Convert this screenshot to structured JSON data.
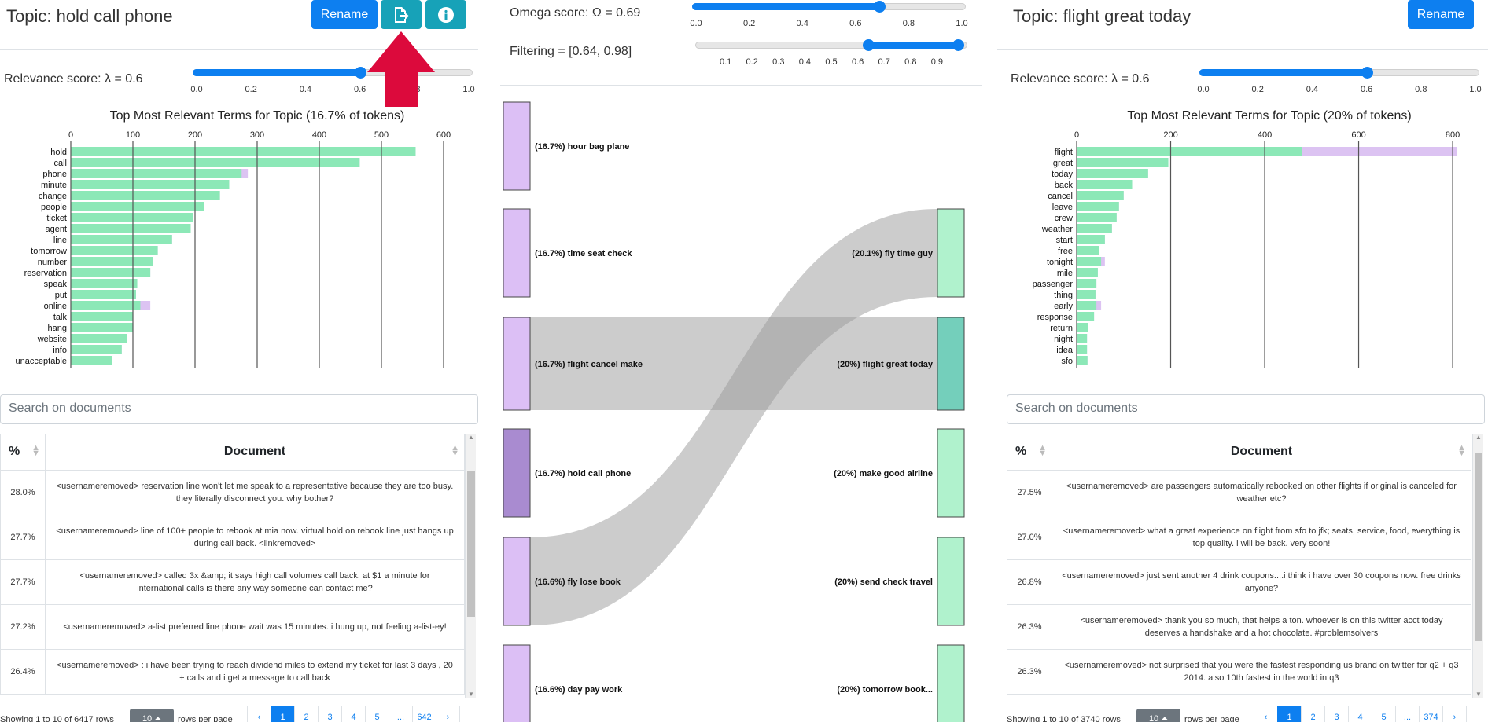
{
  "left": {
    "title": "Topic: hold call phone",
    "rename_label": "Rename",
    "relevance_label": "Relevance score: λ = 0.6",
    "lambda": 0.6,
    "lambda_ticks": [
      "0.0",
      "0.2",
      "0.4",
      "0.6",
      "0.8",
      "1.0"
    ],
    "search_placeholder": "Search on documents",
    "table": {
      "headers": [
        "%",
        "Document"
      ],
      "rows": [
        {
          "pct": "28.0%",
          "doc": "<usernameremoved> reservation line won't let me speak to a representative because they are too busy. they literally disconnect you. why bother?"
        },
        {
          "pct": "27.7%",
          "doc": "<usernameremoved> line of 100+ people to rebook at mia now. virtual hold on rebook line just hangs up during call back. <linkremoved>"
        },
        {
          "pct": "27.7%",
          "doc": "<usernameremoved> called 3x &amp; it says high call volumes call back. at $1 a minute for international calls is there any way someone can contact me?"
        },
        {
          "pct": "27.2%",
          "doc": "<usernameremoved> a-list preferred line phone wait was 15 minutes. i hung up, not feeling a-list-ey!"
        },
        {
          "pct": "26.4%",
          "doc": "<usernameremoved> : i have been trying to reach dividend miles to extend my ticket for last 3 days , 20 + calls and i get a message to call back"
        }
      ]
    },
    "pager": {
      "info": "Showing 1 to 10 of 6417 rows",
      "rows_per_page_value": "10",
      "rows_per_page_label": "rows per page",
      "pages": [
        "‹",
        "1",
        "2",
        "3",
        "4",
        "5",
        "...",
        "642",
        "›"
      ],
      "active_page": "1"
    }
  },
  "middle": {
    "omega_label": "Omega score: Ω = 0.69",
    "omega": 0.69,
    "omega_ticks": [
      "0.0",
      "0.2",
      "0.4",
      "0.6",
      "0.8",
      "1.0"
    ],
    "filter_label": "Filtering = [0.64, 0.98]",
    "filter_range": [
      0.64,
      0.98
    ],
    "filter_ticks": [
      "0.1",
      "0.2",
      "0.3",
      "0.4",
      "0.5",
      "0.6",
      "0.7",
      "0.8",
      "0.9"
    ],
    "left_nodes": [
      "(16.7%) hour bag plane",
      "(16.7%) time seat check",
      "(16.7%) flight cancel make",
      "(16.7%) hold call phone",
      "(16.6%) fly lose book",
      "(16.6%) day pay work"
    ],
    "right_nodes": [
      "(20.1%) fly time guy",
      "(20%) flight great today",
      "(20%) make good airline",
      "(20%) send check travel",
      "(20%) tomorrow book..."
    ],
    "links": [
      {
        "source": "(16.7%) flight cancel make",
        "target": "(20%) flight great today",
        "value": 0.98
      },
      {
        "source": "(16.6%) fly lose book",
        "target": "(20.1%) fly time guy",
        "value": 0.86
      }
    ],
    "colors": {
      "left_node": "#dcbff5",
      "selected_left": "#a98bd0",
      "right_node": "#b0f2cd",
      "selected_right": "#74cfbb",
      "link": "#9a9a9a"
    }
  },
  "right": {
    "title": "Topic: flight great today",
    "rename_label": "Rename",
    "relevance_label": "Relevance score: λ = 0.6",
    "lambda": 0.6,
    "lambda_ticks": [
      "0.0",
      "0.2",
      "0.4",
      "0.6",
      "0.8",
      "1.0"
    ],
    "search_placeholder": "Search on documents",
    "table": {
      "headers": [
        "%",
        "Document"
      ],
      "rows": [
        {
          "pct": "27.5%",
          "doc": "<usernameremoved> are passengers automatically rebooked on other flights if original is canceled for weather etc?"
        },
        {
          "pct": "27.0%",
          "doc": "<usernameremoved> what a great experience on flight from sfo to jfk; seats, service, food, everything is top quality. i will be back. very soon!"
        },
        {
          "pct": "26.8%",
          "doc": "<usernameremoved> just sent another 4 drink coupons....i think i have over 30 coupons now. free drinks anyone?"
        },
        {
          "pct": "26.3%",
          "doc": "<usernameremoved> thank you so much, that helps a ton. whoever is on this twitter acct today deserves a handshake and a hot chocolate. #problemsolvers"
        },
        {
          "pct": "26.3%",
          "doc": "<usernameremoved> not surprised that you were the fastest responding us brand on twitter for q2 + q3 2014. also 10th fastest in the world in q3"
        }
      ]
    },
    "pager": {
      "info": "Showing 1 to 10 of 3740 rows",
      "rows_per_page_value": "10",
      "rows_per_page_label": "rows per page",
      "pages": [
        "‹",
        "1",
        "2",
        "3",
        "4",
        "5",
        "...",
        "374",
        "›"
      ],
      "active_page": "1"
    }
  },
  "chart_data": [
    {
      "type": "bar",
      "orientation": "horizontal",
      "title": "Top Most Relevant Terms for Topic (16.7% of tokens)",
      "xlim": [
        0,
        600
      ],
      "xticks": [
        "0",
        "100",
        "200",
        "300",
        "400",
        "500",
        "600"
      ],
      "categories": [
        "hold",
        "call",
        "phone",
        "minute",
        "change",
        "people",
        "ticket",
        "agent",
        "line",
        "tomorrow",
        "number",
        "reservation",
        "speak",
        "put",
        "online",
        "talk",
        "hang",
        "website",
        "info",
        "unacceptable"
      ],
      "series": [
        {
          "values": [
            555,
            465,
            275,
            255,
            240,
            215,
            197,
            193,
            163,
            140,
            132,
            128,
            107,
            105,
            112,
            100,
            100,
            90,
            82,
            67
          ]
        },
        {
          "values": [
            555,
            465,
            285,
            255,
            240,
            215,
            197,
            193,
            163,
            140,
            132,
            128,
            107,
            105,
            128,
            100,
            100,
            90,
            82,
            67
          ]
        }
      ],
      "colors": [
        "#8ce8b7",
        "#dcc3f2"
      ]
    },
    {
      "type": "bar",
      "orientation": "horizontal",
      "title": "Top Most Relevant Terms for Topic (20% of tokens)",
      "xlim": [
        0,
        820
      ],
      "xticks": [
        "0",
        "200",
        "400",
        "600",
        "800"
      ],
      "categories": [
        "flight",
        "great",
        "today",
        "back",
        "cancel",
        "leave",
        "crew",
        "weather",
        "start",
        "free",
        "tonight",
        "mile",
        "passenger",
        "thing",
        "early",
        "response",
        "return",
        "night",
        "idea",
        "sfo"
      ],
      "series": [
        {
          "values": [
            480,
            195,
            152,
            118,
            100,
            90,
            85,
            75,
            60,
            48,
            52,
            45,
            42,
            40,
            42,
            37,
            25,
            22,
            22,
            23
          ]
        },
        {
          "values": [
            810,
            195,
            152,
            118,
            100,
            90,
            85,
            75,
            60,
            48,
            60,
            45,
            42,
            40,
            52,
            37,
            25,
            22,
            22,
            23
          ]
        }
      ],
      "colors": [
        "#8ce8b7",
        "#dcc3f2"
      ]
    }
  ]
}
